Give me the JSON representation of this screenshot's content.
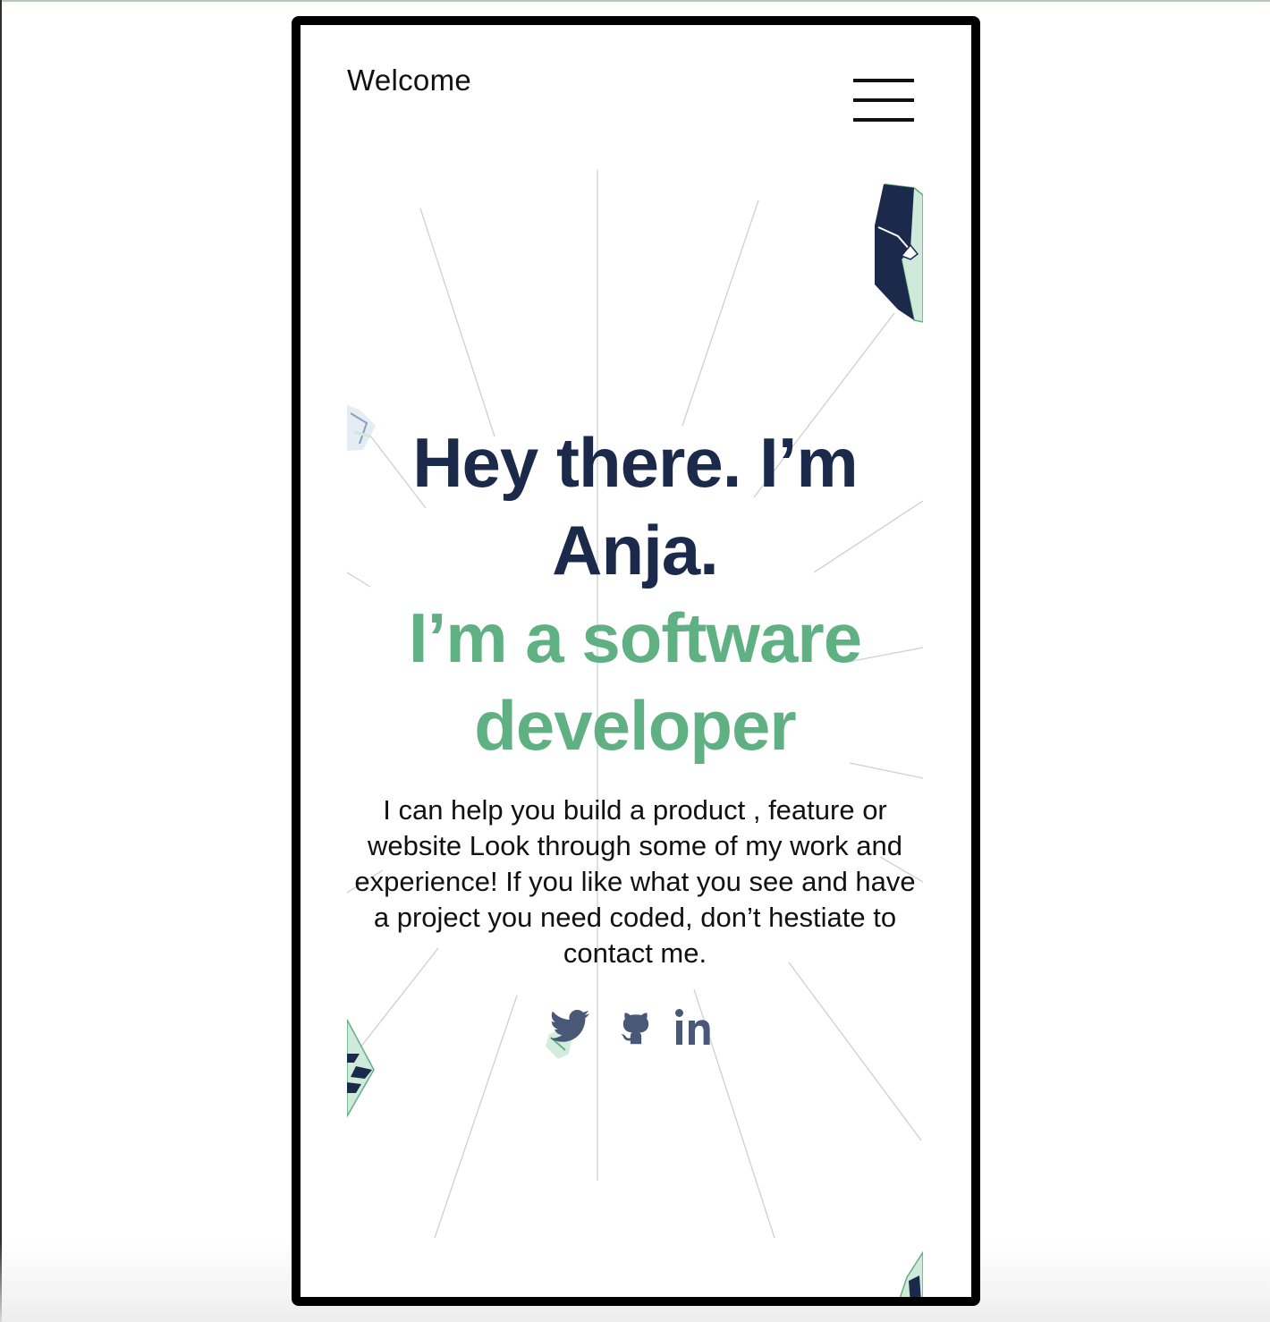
{
  "header": {
    "title": "Welcome",
    "menu_icon": "hamburger-menu-icon"
  },
  "hero": {
    "greeting_line1": "Hey there. I’m",
    "greeting_line2": "Anja.",
    "role_line1": "I’m a software",
    "role_line2": "developer"
  },
  "bio": {
    "text": "I can help you build a product , feature or website Look through some of my work and experience! If you like what you see and have a project you need coded, don’t hestiate to contact me."
  },
  "socials": [
    {
      "icon": "twitter-icon"
    },
    {
      "icon": "github-icon"
    },
    {
      "icon": "linkedin-icon",
      "label": "in"
    }
  ],
  "colors": {
    "heading": "#1b2a4a",
    "accent": "#5fb083",
    "mint": "#cfeadb",
    "social": "#4a5878"
  }
}
